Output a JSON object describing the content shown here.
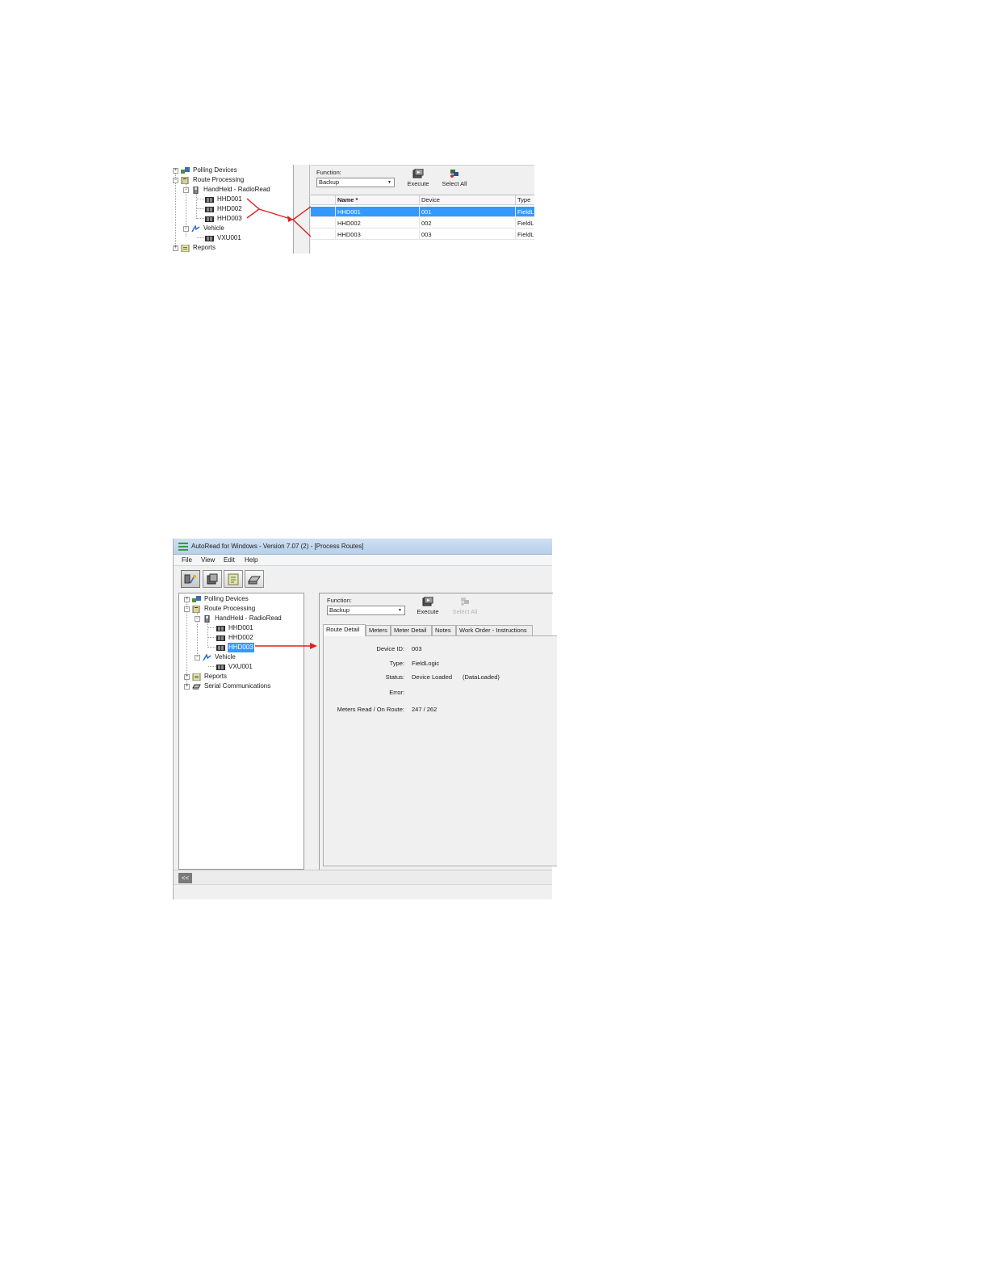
{
  "shot1": {
    "tree": {
      "polling_devices": "Polling Devices",
      "route_processing": "Route Processing",
      "handheld": "HandHeld - RadioRead",
      "hhd001": "HHD001",
      "hhd002": "HHD002",
      "hhd003": "HHD003",
      "vehicle": "Vehicle",
      "vxu001": "VXU001",
      "reports": "Reports"
    },
    "function_label": "Function:",
    "function_value": "Backup",
    "execute_label": "Execute",
    "select_all_label": "Select All",
    "grid": {
      "columns": [
        "Name *",
        "Device",
        "Type"
      ],
      "rows": [
        [
          "HHD001",
          "001",
          "FieldL"
        ],
        [
          "HHD002",
          "002",
          "FieldL"
        ],
        [
          "HHD003",
          "003",
          "FieldL"
        ]
      ]
    }
  },
  "shot2": {
    "title": "AutoRead for Windows - Version 7.07 (2) - [Process Routes]",
    "menu": [
      "File",
      "View",
      "Edit",
      "Help"
    ],
    "tree": {
      "polling_devices": "Polling Devices",
      "route_processing": "Route Processing",
      "handheld": "HandHeld - RadioRead",
      "hhd001": "HHD001",
      "hhd002": "HHD002",
      "hhd003": "HHD003",
      "vehicle": "Vehicle",
      "vxu001": "VXU001",
      "reports": "Reports",
      "serial": "Serial Communications"
    },
    "function_label": "Function:",
    "function_value": "Backup",
    "execute_label": "Execute",
    "select_all_label": "Select All",
    "tabs": [
      "Route Detail",
      "Meters",
      "Meter Detail",
      "Notes",
      "Work Order - Instructions"
    ],
    "detail": {
      "device_id_label": "Device ID:",
      "device_id": "003",
      "type_label": "Type:",
      "type": "FieldLogic",
      "status_label": "Status:",
      "status": "Device Loaded",
      "status_extra": "(DataLoaded)",
      "error_label": "Error:",
      "meters_label": "Meters Read / On Route:",
      "meters": "247 / 262"
    },
    "collapse_label": "<<"
  },
  "colors": {
    "selection": "#3399ff",
    "annotation_arrow": "#e02020"
  }
}
